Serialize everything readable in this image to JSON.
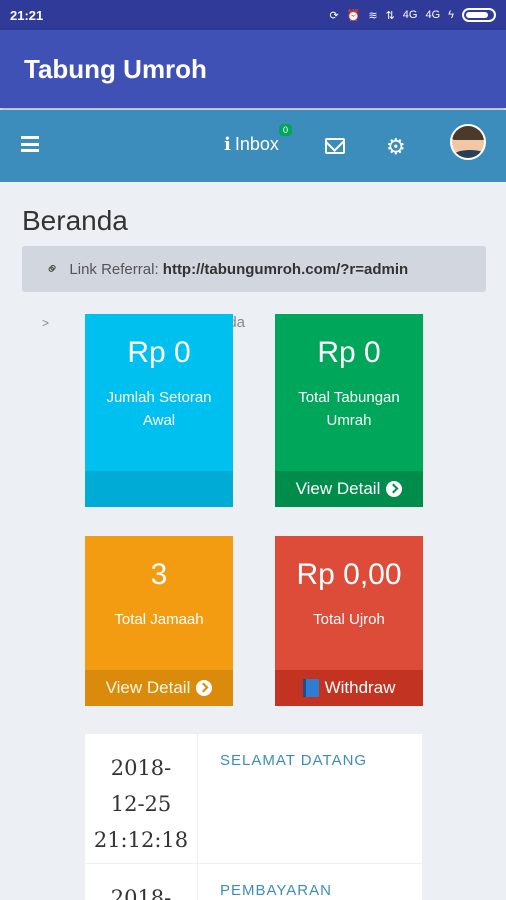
{
  "status_bar": {
    "time": "21:21",
    "network": "4G",
    "network2": "4G"
  },
  "app_bar": {
    "title": "Tabung Umroh"
  },
  "toolbar": {
    "inbox_label": "Inbox",
    "inbox_count": "0"
  },
  "page": {
    "title": "Beranda",
    "referral_label": "Link Referral:",
    "referral_url": "http://tabungumroh.com/?r=admin",
    "breadcrumb_current": "nda"
  },
  "tiles": [
    {
      "value": "Rp 0",
      "label": "Jumlah Setoran Awal",
      "footer": "",
      "color": "#00c0ef"
    },
    {
      "value": "Rp 0",
      "label": "Total Tabungan Umrah",
      "footer": "View Detail",
      "color": "#00a65a"
    },
    {
      "value": "3",
      "label": "Total Jamaah",
      "footer": "View Detail",
      "color": "#f39c12"
    },
    {
      "value": "Rp 0,00",
      "label": "Total Ujroh",
      "footer": "Withdraw",
      "color": "#dd4b39"
    }
  ],
  "messages": [
    {
      "date_line1": "2018-",
      "date_line2": "12-25",
      "date_line3": "21:12:18",
      "title": "SELAMAT DATANG"
    },
    {
      "date_line1": "2018-",
      "title": "PEMBAYARAN"
    }
  ],
  "colors": {
    "primary": "#3f51b5",
    "toolbar": "#3c8dbc",
    "background": "#ecf0f5"
  }
}
